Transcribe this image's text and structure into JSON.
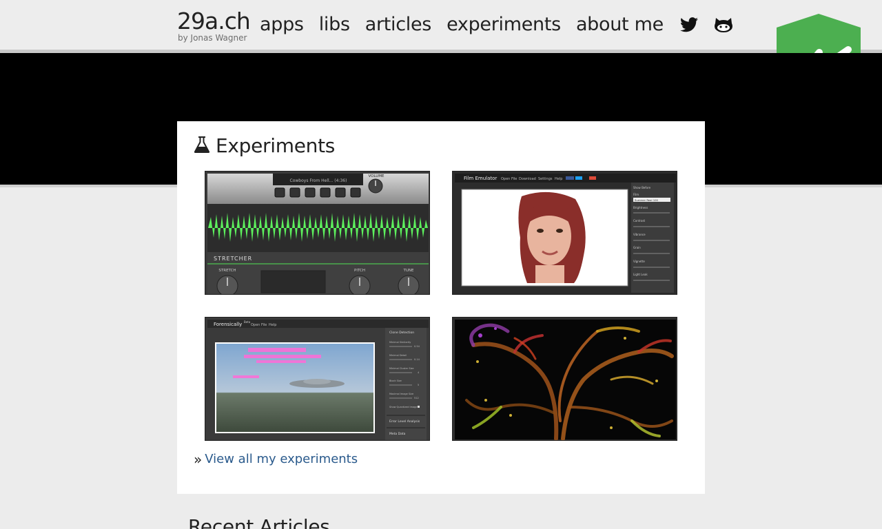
{
  "brand": {
    "title": "29a.ch",
    "byline": "by Jonas Wagner"
  },
  "nav": {
    "items": [
      {
        "label": "apps"
      },
      {
        "label": "libs"
      },
      {
        "label": "articles"
      },
      {
        "label": "experiments"
      },
      {
        "label": "about me"
      }
    ],
    "icons": [
      "twitter-icon",
      "github-icon"
    ]
  },
  "badge": {
    "icon": "shield-check-icon",
    "color": "#4caf50"
  },
  "experiments": {
    "title": "Experiments",
    "icon": "flask-icon",
    "thumbnails": [
      {
        "name": "stretcher",
        "track": "Cowboys From Hell... (4:36)",
        "volume_label": "VOLUME",
        "app_label": "STRETCHER",
        "knobs": [
          "STRETCH",
          "PITCH",
          "TUNE"
        ],
        "waveform_color": "#5df05d"
      },
      {
        "name": "film-emulator",
        "app_title": "Film Emulator",
        "menu": [
          "Open File",
          "Download",
          "Settings",
          "Help"
        ],
        "panel": [
          "Show Before",
          "Film",
          "Brightness",
          "Contrast",
          "Vibrance",
          "Grain",
          "Vignette",
          "Light Leak"
        ],
        "film_value": "Summer Real 100"
      },
      {
        "name": "forensically",
        "app_title": "Forensically",
        "beta": "Beta",
        "menu": [
          "Open File",
          "Help"
        ],
        "panel": [
          "Clone Detection",
          "Minimal Similarity",
          "Minimal Detail",
          "Minimal Cluster Size",
          "Block Size",
          "Maximal Image Size",
          "Show Quantized Image",
          "Error Level Analysis",
          "Meta Data"
        ],
        "panel_values": [
          "0.54",
          "0.14",
          "4",
          "5",
          "512"
        ]
      },
      {
        "name": "fluid-simulation"
      }
    ],
    "view_all": "View all my experiments"
  },
  "recent": {
    "title": "Recent Articles"
  }
}
